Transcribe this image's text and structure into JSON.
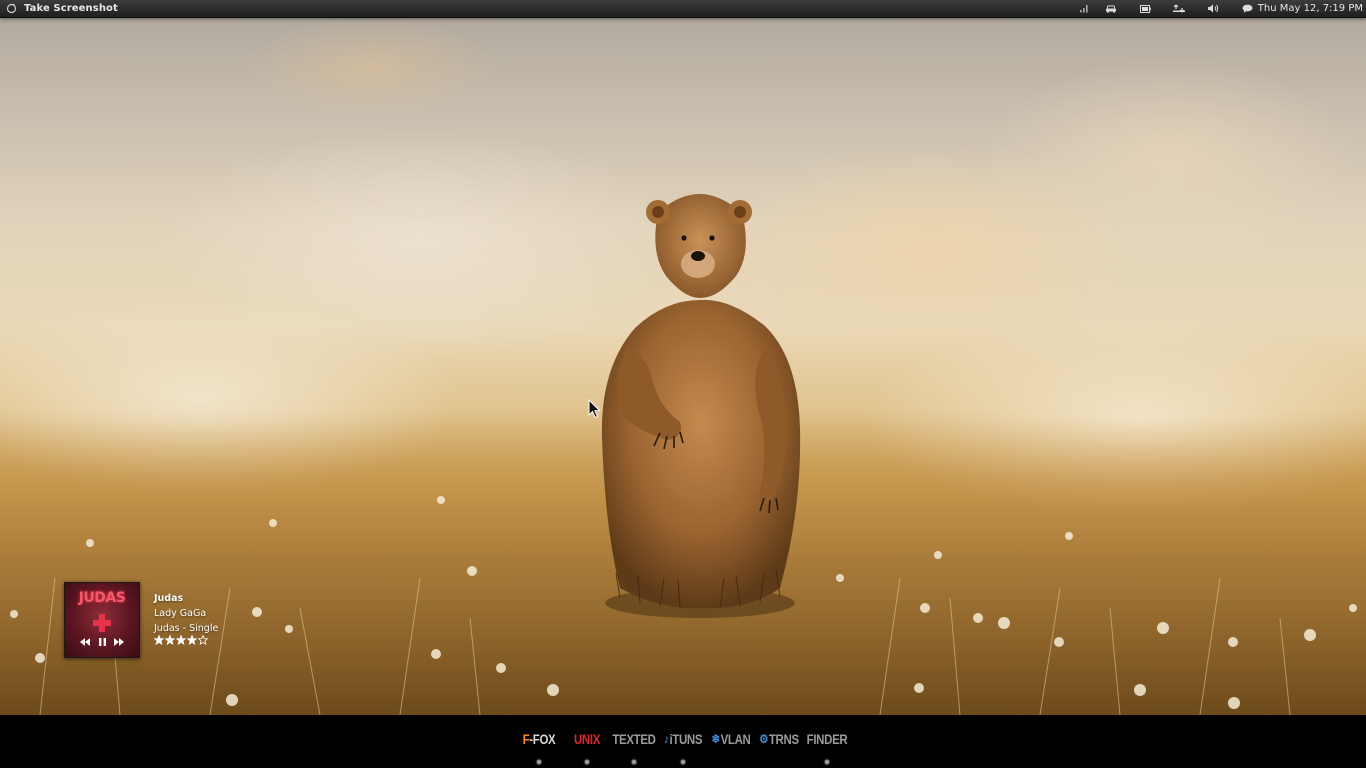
{
  "top_panel": {
    "app_title": "Take Screenshot",
    "clock": "Thu May 12,  7:19 PM",
    "tray_icons": [
      "signal-icon",
      "car-icon",
      "battery-icon",
      "network-icon",
      "volume-icon",
      "chat-icon"
    ]
  },
  "now_playing": {
    "album_art_text": "JUDAS",
    "title": "Judas",
    "artist": "Lady GaGa",
    "album": "Judas - Single",
    "rating": 4,
    "rating_max": 5
  },
  "dock": {
    "items": [
      {
        "prefix": "F",
        "label": "-FOX",
        "prefix_color": "#ff8a00",
        "color": "#d8d8d8",
        "running": true
      },
      {
        "prefix": "",
        "label": "UNIX",
        "prefix_color": "#e0242a",
        "color": "#e0242a",
        "running": true
      },
      {
        "prefix": "",
        "label": "TEXTED",
        "prefix_color": "#9a9a9a",
        "color": "#9a9a9a",
        "running": true
      },
      {
        "prefix": "",
        "label": "iTUNS",
        "prefix_color": "#3b8bd8",
        "color": "#9a9a9a",
        "running": true
      },
      {
        "prefix": "",
        "label": "VLAN",
        "prefix_color": "#3b8bd8",
        "color": "#9a9a9a",
        "running": false
      },
      {
        "prefix": "",
        "label": "TRNS",
        "prefix_color": "#3b8bd8",
        "color": "#9a9a9a",
        "running": false
      },
      {
        "prefix": "",
        "label": "FINDER",
        "prefix_color": "#9a9a9a",
        "color": "#9a9a9a",
        "running": true
      }
    ]
  }
}
